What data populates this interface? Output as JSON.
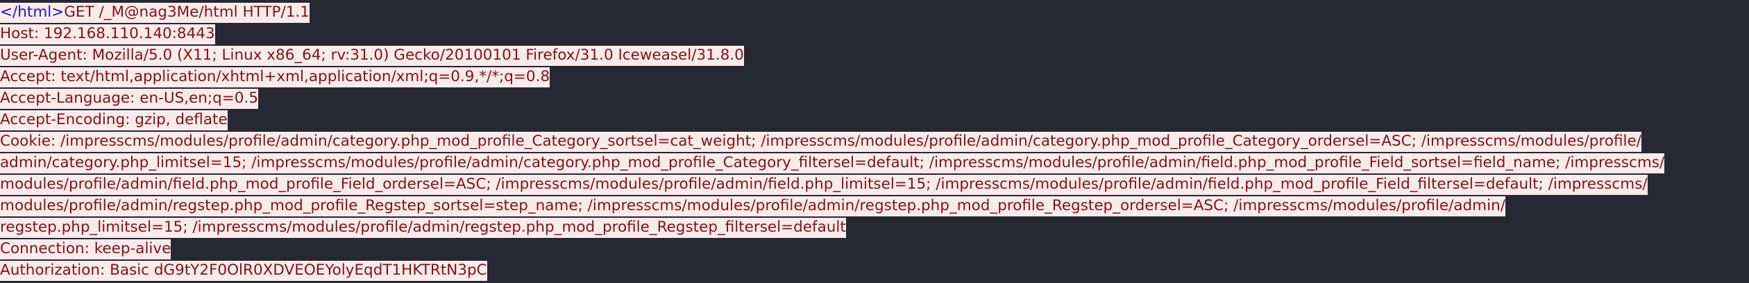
{
  "stream": {
    "prefix_tag": "</html>",
    "request_line": "GET /_M@nag3Me/html HTTP/1.1",
    "lines": [
      "Host: 192.168.110.140:8443",
      "User-Agent: Mozilla/5.0 (X11; Linux x86_64; rv:31.0) Gecko/20100101 Firefox/31.0 Iceweasel/31.8.0",
      "Accept: text/html,application/xhtml+xml,application/xml;q=0.9,*/*;q=0.8",
      "Accept-Language: en-US,en;q=0.5",
      "Accept-Encoding: gzip, deflate",
      "Cookie: /impresscms/modules/profile/admin/category.php_mod_profile_Category_sortsel=cat_weight; /impresscms/modules/profile/admin/category.php_mod_profile_Category_ordersel=ASC; /impresscms/modules/profile/",
      "admin/category.php_limitsel=15; /impresscms/modules/profile/admin/category.php_mod_profile_Category_filtersel=default; /impresscms/modules/profile/admin/field.php_mod_profile_Field_sortsel=field_name; /impresscms/",
      "modules/profile/admin/field.php_mod_profile_Field_ordersel=ASC; /impresscms/modules/profile/admin/field.php_limitsel=15; /impresscms/modules/profile/admin/field.php_mod_profile_Field_filtersel=default; /impresscms/",
      "modules/profile/admin/regstep.php_mod_profile_Regstep_sortsel=step_name; /impresscms/modules/profile/admin/regstep.php_mod_profile_Regstep_ordersel=ASC; /impresscms/modules/profile/admin/",
      "regstep.php_limitsel=15; /impresscms/modules/profile/admin/regstep.php_mod_profile_Regstep_filtersel=default",
      "Connection: keep-alive",
      "Authorization: Basic dG9tY2F0OlR0XDVEOEYolyEqdT1HKTRtN3pC"
    ]
  },
  "colors": {
    "background": "#262833",
    "client_text": "#7f1313",
    "client_highlight": "#faebeb",
    "tag_text": "#1c1cb0"
  }
}
